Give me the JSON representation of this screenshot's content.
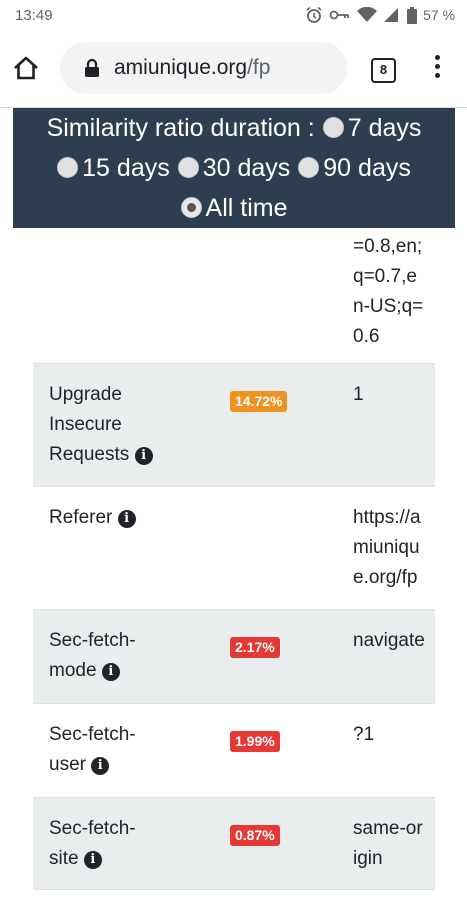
{
  "status_bar": {
    "time": "13:49",
    "battery": "57 %",
    "icons": [
      "alarm-icon",
      "vpn-key-icon",
      "wifi-icon",
      "signal-icon",
      "battery-icon"
    ]
  },
  "browser": {
    "url_domain": "amiunique.org",
    "url_path": "/fp",
    "tab_count": "8",
    "icons": [
      "home-icon",
      "lock-icon",
      "tabs-icon",
      "overflow-menu-icon"
    ]
  },
  "ratio_selector": {
    "title": "Similarity ratio duration :",
    "options": [
      {
        "label": "7 days",
        "checked": false
      },
      {
        "label": "15 days",
        "checked": false
      },
      {
        "label": "30 days",
        "checked": false
      },
      {
        "label": "90 days",
        "checked": false
      },
      {
        "label": "All time",
        "checked": true
      }
    ]
  },
  "table": {
    "rows": [
      {
        "name_lines": [],
        "badge": "",
        "badge_color": "",
        "value_lines": [
          "=0.8,en;",
          "q=0.7,e",
          "n-US;q=",
          "0.6"
        ],
        "info": false,
        "gray": false
      },
      {
        "name_lines": [
          "Upgrade",
          "Insecure",
          "Requests"
        ],
        "badge": "14.72%",
        "badge_color": "#f0921f",
        "value_lines": [
          "1"
        ],
        "info": true,
        "gray": true
      },
      {
        "name_lines": [
          "Referer"
        ],
        "badge": "",
        "badge_color": "",
        "value_lines": [
          "https://a",
          "miuniqu",
          "e.org/fp"
        ],
        "info": true,
        "gray": false
      },
      {
        "name_lines": [
          "Sec-fetch-",
          "mode"
        ],
        "badge": "2.17%",
        "badge_color": "#e53935",
        "value_lines": [
          "navigate"
        ],
        "info": true,
        "gray": true
      },
      {
        "name_lines": [
          "Sec-fetch-",
          "user"
        ],
        "badge": "1.99%",
        "badge_color": "#e53935",
        "value_lines": [
          "?1"
        ],
        "info": true,
        "gray": false
      },
      {
        "name_lines": [
          "Sec-fetch-",
          "site"
        ],
        "badge": "0.87%",
        "badge_color": "#e53935",
        "value_lines": [
          "same-or",
          "igin"
        ],
        "info": true,
        "gray": true
      }
    ]
  }
}
